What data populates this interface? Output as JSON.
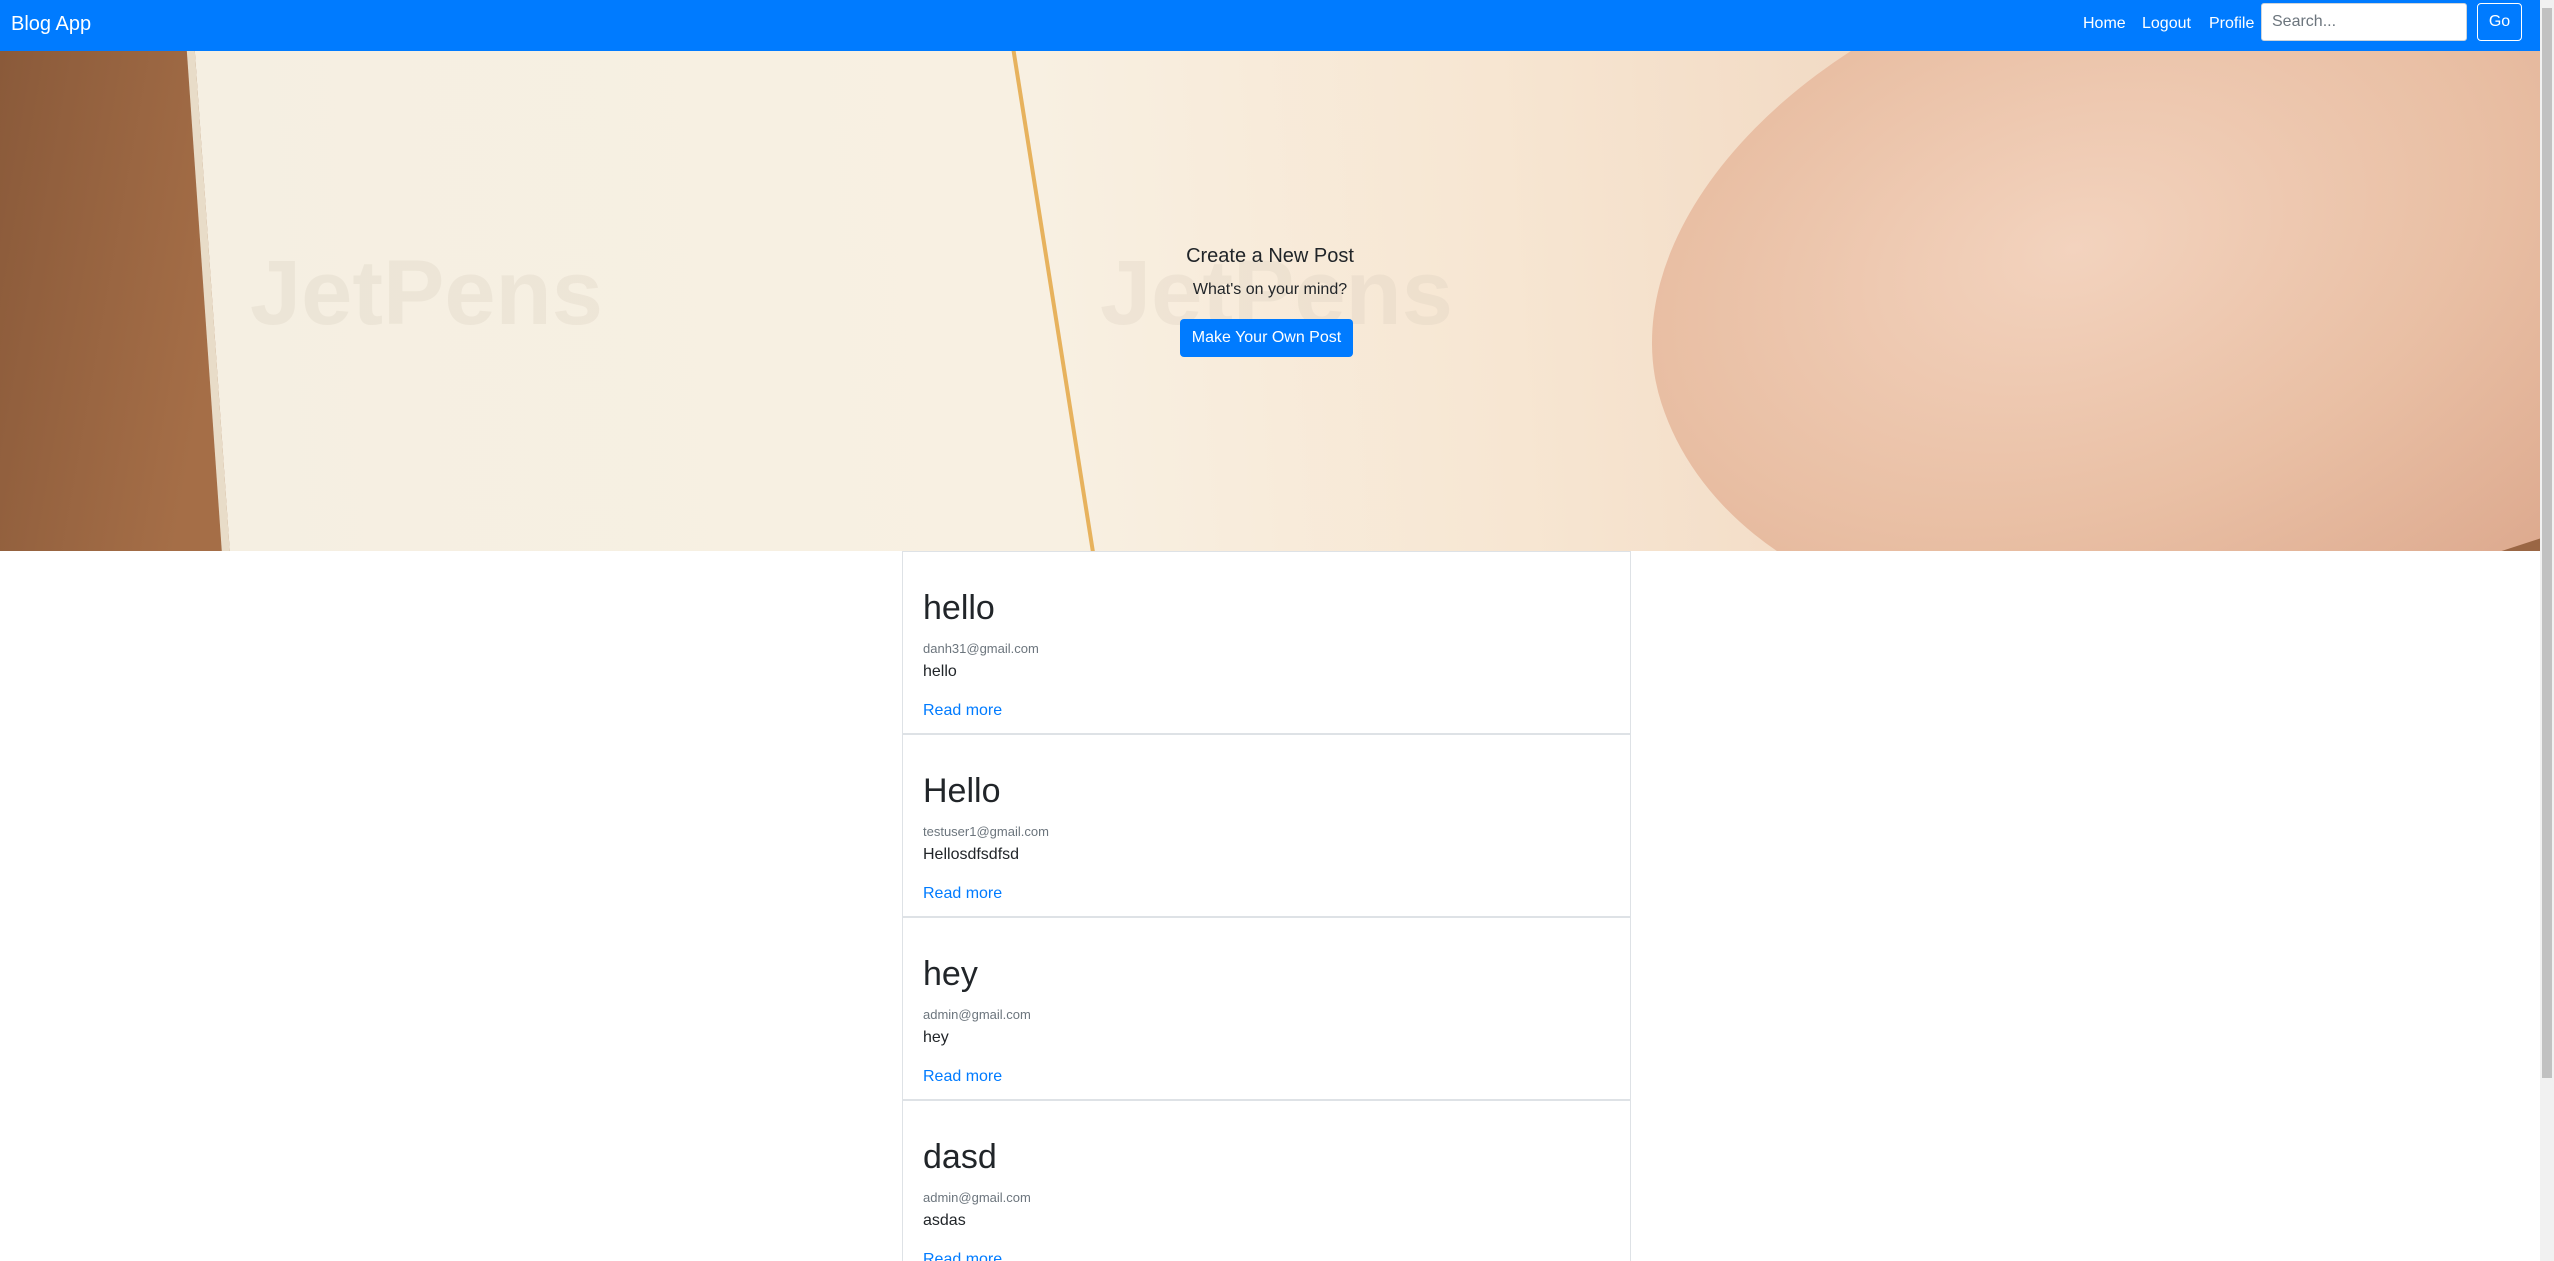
{
  "navbar": {
    "brand": "Blog App",
    "links": [
      "Home",
      "Logout",
      "Profile"
    ],
    "search_placeholder": "Search...",
    "go_label": "Go"
  },
  "hero": {
    "title": "Create a New Post",
    "subtitle": "What's on your mind?",
    "button_label": "Make Your Own Post",
    "watermark": "JetPens"
  },
  "posts": [
    {
      "title": "hello",
      "author": "danh31@gmail.com",
      "excerpt": "hello",
      "link": "Read more"
    },
    {
      "title": "Hello",
      "author": "testuser1@gmail.com",
      "excerpt": "Hellosdfsdfsd",
      "link": "Read more"
    },
    {
      "title": "hey",
      "author": "admin@gmail.com",
      "excerpt": "hey",
      "link": "Read more"
    },
    {
      "title": "dasd",
      "author": "admin@gmail.com",
      "excerpt": "asdas",
      "link": "Read more"
    }
  ],
  "colors": {
    "primary": "#007bff",
    "muted": "#6c757d",
    "text": "#212529"
  }
}
